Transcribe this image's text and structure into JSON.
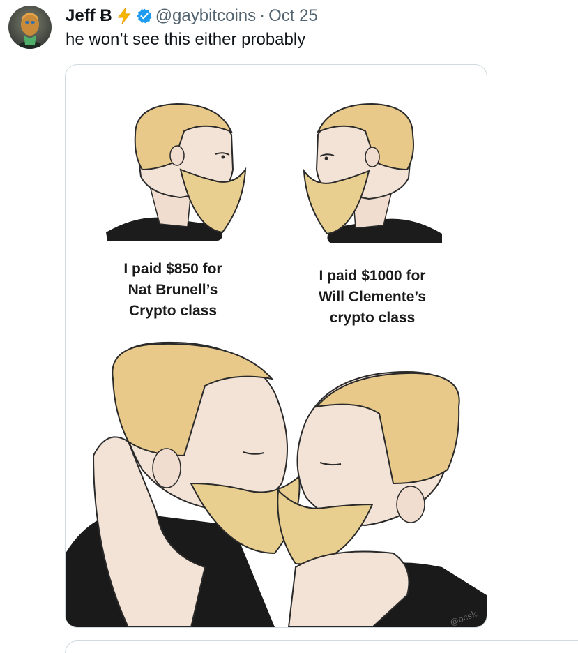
{
  "tweet": {
    "display_name": "Jeff Ƀ",
    "handle": "@gaybitcoins",
    "separator": "·",
    "time": "Oct 25",
    "text": "he won’t see this either probably"
  },
  "meme": {
    "caption_left": "I paid $850 for\nNat Brunell’s\nCrypto class",
    "caption_right": "I paid $1000 for\nWill Clemente’s\ncrypto class",
    "watermark": "@ocsk"
  },
  "icons": {
    "emoji": "lightning-icon",
    "verified": "verified-badge-icon"
  },
  "colors": {
    "verified": "#1d9bf0",
    "lightning": "#f7b500",
    "secondary_text": "#536471",
    "hair": "#e9cf8f"
  }
}
